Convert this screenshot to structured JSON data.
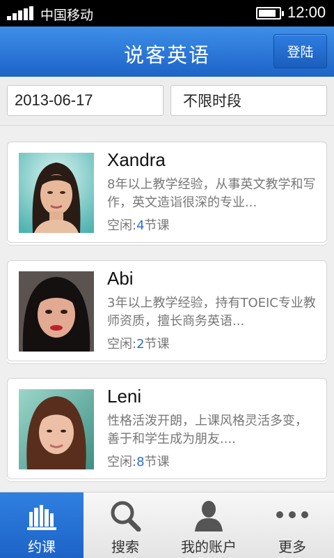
{
  "status_bar": {
    "carrier": "中国移动",
    "time": "12:00",
    "battery_level": 0.85
  },
  "header": {
    "title": "说客英语",
    "login_label": "登陆"
  },
  "filters": {
    "date": "2013-06-17",
    "time_slot": "不限时段"
  },
  "teachers": [
    {
      "name": "Xandra",
      "description": "8年以上教学经验，从事英文教学和写作，英文造诣很深的专业...",
      "slots_prefix": "空闲:",
      "slots_count": "4",
      "slots_suffix": "节课"
    },
    {
      "name": "Abi",
      "description": "3年以上教学经验，持有TOEIC专业教师资质，擅长商务英语...",
      "slots_prefix": "空闲:",
      "slots_count": "2",
      "slots_suffix": "节课"
    },
    {
      "name": "Leni",
      "description": "性格活泼开朗，上课风格灵活多变，善于和学生成为朋友....",
      "slots_prefix": "空闲:",
      "slots_count": "8",
      "slots_suffix": "节课"
    }
  ],
  "tabs": [
    {
      "label": "约课",
      "icon": "books-icon",
      "active": true
    },
    {
      "label": "搜索",
      "icon": "search-icon",
      "active": false
    },
    {
      "label": "我的账户",
      "icon": "person-icon",
      "active": false
    },
    {
      "label": "更多",
      "icon": "more-dots-icon",
      "active": false
    }
  ],
  "colors": {
    "accent": "#1d63c7",
    "slot_number": "#2a6fc9"
  }
}
